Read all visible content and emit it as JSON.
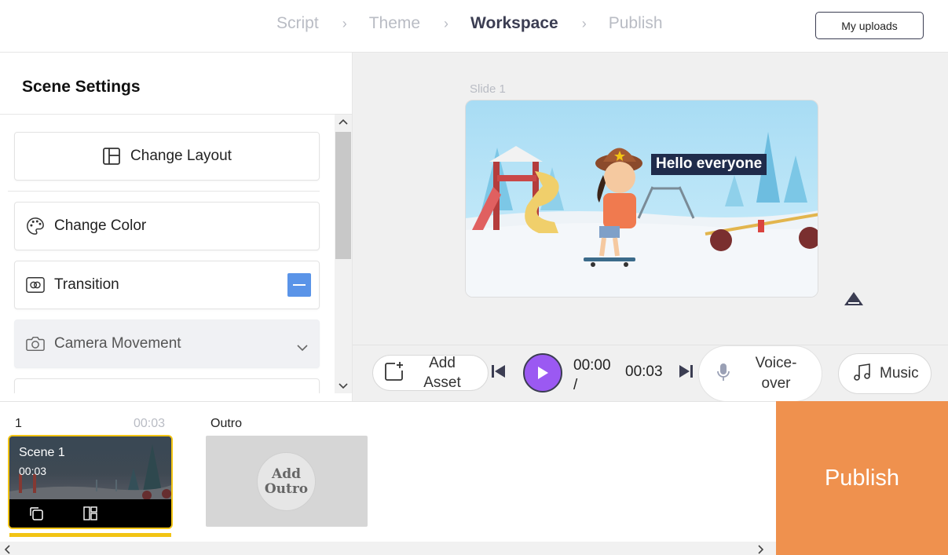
{
  "header": {
    "steps": [
      {
        "label": "Script",
        "state": "inactive"
      },
      {
        "label": "Theme",
        "state": "inactive"
      },
      {
        "label": "Workspace",
        "state": "active"
      },
      {
        "label": "Publish",
        "state": "inactive"
      }
    ],
    "separator": "›",
    "uploads_label": "My uploads"
  },
  "scene_settings": {
    "title": "Scene Settings",
    "change_layout": "Change Layout",
    "change_color": "Change Color",
    "transition": "Transition",
    "camera_movement": "Camera Movement"
  },
  "preview": {
    "slide_label": "Slide 1",
    "caption": "Hello everyone"
  },
  "controls": {
    "add_asset": "Add Asset",
    "time_current": "00:00 /",
    "time_total": "00:03",
    "voiceover": "Voice-over",
    "music": "Music"
  },
  "timeline": {
    "scene_index": "1",
    "scene_duration": "00:03",
    "scene_title": "Scene 1",
    "scene_time": "00:03",
    "outro_label": "Outro",
    "add_outro": "Add Outro"
  },
  "publish_label": "Publish",
  "colors": {
    "accent_purple": "#9b59f2",
    "publish_orange": "#ef914e",
    "scene_highlight": "#f2c414",
    "toggle_blue": "#5a94e8",
    "active_step": "#3b3d52"
  }
}
